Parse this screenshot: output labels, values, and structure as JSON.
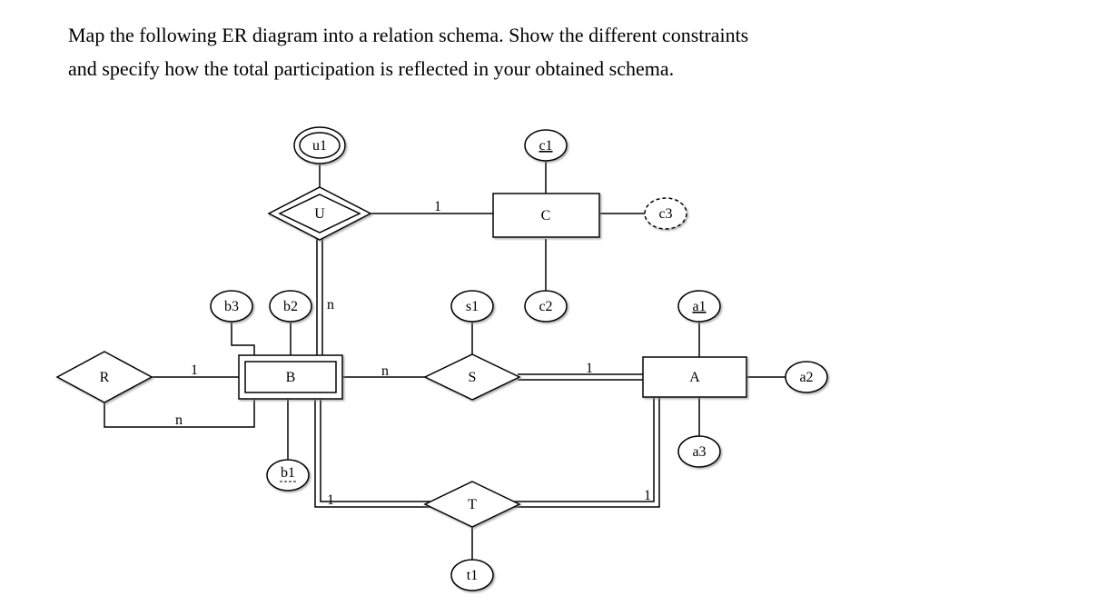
{
  "prompt": {
    "line1": "Map the following ER diagram into a relation schema. Show the different constraints",
    "line2": "and specify how the total participation is reflected in your obtained schema."
  },
  "entities": {
    "B": {
      "label": "B",
      "weak": true
    },
    "C": {
      "label": "C"
    },
    "A": {
      "label": "A"
    }
  },
  "relationships": {
    "R": {
      "label": "R"
    },
    "U": {
      "label": "U",
      "identifying": true
    },
    "S": {
      "label": "S"
    },
    "T": {
      "label": "T"
    }
  },
  "attributes": {
    "u1": {
      "label": "u1",
      "multivalued": true
    },
    "c1": {
      "label": "c1",
      "key": true
    },
    "c3": {
      "label": "c3",
      "derived": true
    },
    "b3": {
      "label": "b3"
    },
    "b2": {
      "label": "b2"
    },
    "s1": {
      "label": "s1"
    },
    "c2": {
      "label": "c2"
    },
    "a1": {
      "label": "a1",
      "key": true
    },
    "a2": {
      "label": "a2"
    },
    "a3": {
      "label": "a3"
    },
    "b1": {
      "label": "b1",
      "partial_key": true
    },
    "t1": {
      "label": "t1"
    }
  },
  "cardinalities": {
    "U_C": "1",
    "U_B": "n",
    "R_B": "1",
    "R_self": "n",
    "B_S": "n",
    "S_A": "1",
    "B_T": "1",
    "T_A": "1"
  },
  "chart_data": {
    "type": "er-diagram",
    "entities": [
      {
        "name": "A",
        "attributes": [
          "a1",
          "a2",
          "a3"
        ],
        "key": "a1"
      },
      {
        "name": "B",
        "weak": true,
        "attributes": [
          "b1",
          "b2",
          "b3"
        ],
        "partial_key": "b1"
      },
      {
        "name": "C",
        "attributes": [
          "c1",
          "c2",
          "c3"
        ],
        "key": "c1",
        "derived": [
          "c3"
        ]
      }
    ],
    "relationships": [
      {
        "name": "R",
        "participants": [
          {
            "entity": "B",
            "card": "1"
          },
          {
            "entity": "B",
            "card": "n"
          }
        ],
        "recursive_on": "B"
      },
      {
        "name": "U",
        "identifying_for": "B",
        "attributes": [
          "u1"
        ],
        "multivalued_attrs": [
          "u1"
        ],
        "participants": [
          {
            "entity": "B",
            "card": "n",
            "total": true
          },
          {
            "entity": "C",
            "card": "1"
          }
        ]
      },
      {
        "name": "S",
        "attributes": [
          "s1"
        ],
        "participants": [
          {
            "entity": "B",
            "card": "n"
          },
          {
            "entity": "A",
            "card": "1",
            "total": true
          }
        ]
      },
      {
        "name": "T",
        "attributes": [
          "t1"
        ],
        "participants": [
          {
            "entity": "B",
            "card": "1",
            "total": true
          },
          {
            "entity": "A",
            "card": "1",
            "total": true
          }
        ]
      }
    ]
  }
}
